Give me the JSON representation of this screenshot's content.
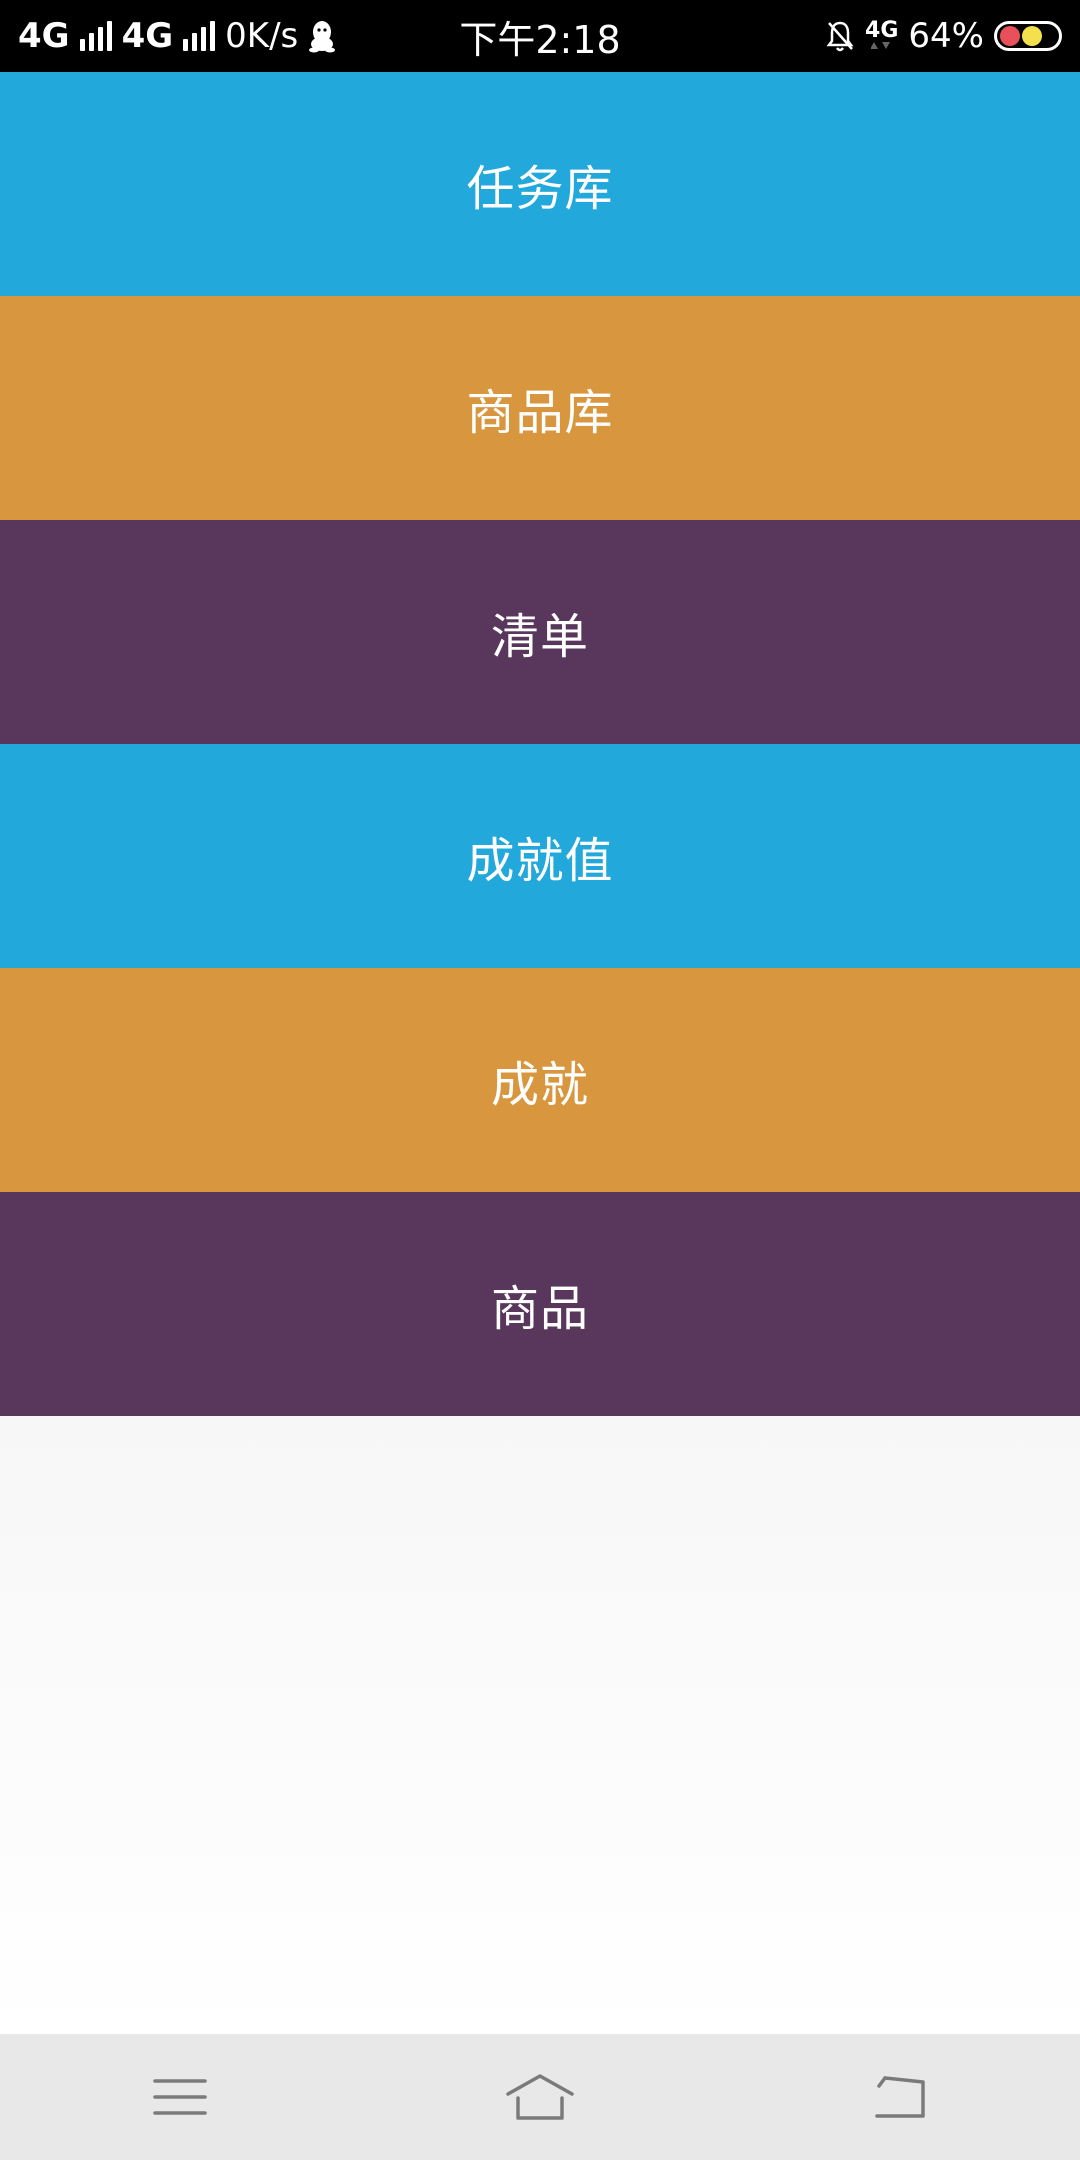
{
  "status_bar": {
    "network_1": "4G",
    "network_2": "4G",
    "speed": "0K/s",
    "time": "下午2:18",
    "data_network": "4G",
    "battery": "64%",
    "icons": [
      "signal-icon",
      "qq-icon",
      "bell-muted-icon",
      "data-4g-icon",
      "battery-icon"
    ],
    "battery_dot_colors": [
      "#e8505b",
      "#f4e04d"
    ]
  },
  "menu": {
    "items": [
      {
        "label": "任务库",
        "color": "#22a8db"
      },
      {
        "label": "商品库",
        "color": "#d8973f"
      },
      {
        "label": "清单",
        "color": "#59375d"
      },
      {
        "label": "成就值",
        "color": "#22a8db"
      },
      {
        "label": "成就",
        "color": "#d8973f"
      },
      {
        "label": "商品",
        "color": "#59375d"
      }
    ]
  },
  "nav_bar": {
    "icons": [
      "menu-icon",
      "home-icon",
      "back-icon"
    ],
    "background": "#e8e8e8"
  }
}
